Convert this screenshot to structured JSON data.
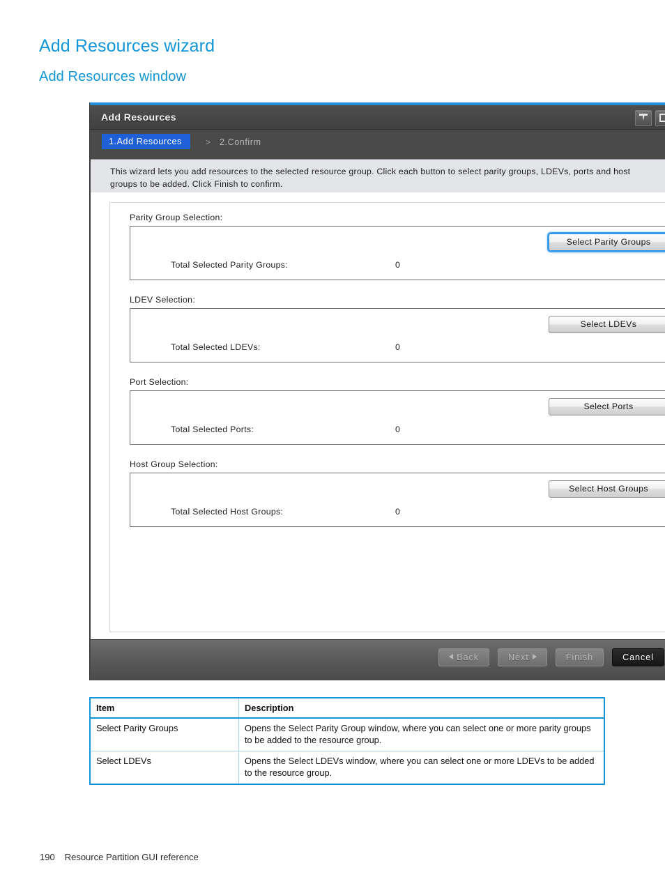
{
  "document": {
    "heading": "Add Resources wizard",
    "subheading": "Add Resources window",
    "page_number": "190",
    "footer_text": "Resource Partition GUI reference",
    "accent_color": "#1296d8"
  },
  "dialog": {
    "title": "Add Resources",
    "window_buttons": [
      {
        "name": "pin-icon"
      },
      {
        "name": "maximize-icon"
      }
    ],
    "steps": {
      "active": "1.Add Resources",
      "separator": ">",
      "next": "2.Confirm"
    },
    "description": "This wizard lets you add resources to the selected resource group. Click each button to select parity groups, LDEVs, ports and host groups to be added. Click Finish to confirm.",
    "sections": [
      {
        "label": "Parity Group Selection:",
        "button": "Select Parity Groups",
        "focused": true,
        "total_label": "Total Selected Parity Groups:",
        "total_value": "0"
      },
      {
        "label": "LDEV Selection:",
        "button": "Select LDEVs",
        "focused": false,
        "total_label": "Total Selected LDEVs:",
        "total_value": "0"
      },
      {
        "label": "Port Selection:",
        "button": "Select Ports",
        "focused": false,
        "total_label": "Total Selected Ports:",
        "total_value": "0"
      },
      {
        "label": "Host Group Selection:",
        "button": "Select Host Groups",
        "focused": false,
        "total_label": "Total Selected Host Groups:",
        "total_value": "0"
      }
    ],
    "footer_buttons": {
      "back": "Back",
      "next": "Next",
      "finish": "Finish",
      "cancel": "Cancel"
    }
  },
  "reference_table": {
    "headers": [
      "Item",
      "Description"
    ],
    "rows": [
      {
        "item": "Select Parity Groups",
        "description": "Opens the Select Parity Group window, where you can select one or more parity groups to be added to the resource group."
      },
      {
        "item": "Select LDEVs",
        "description": "Opens the Select LDEVs window, where you can select one or more LDEVs to be added to the resource group."
      }
    ]
  }
}
